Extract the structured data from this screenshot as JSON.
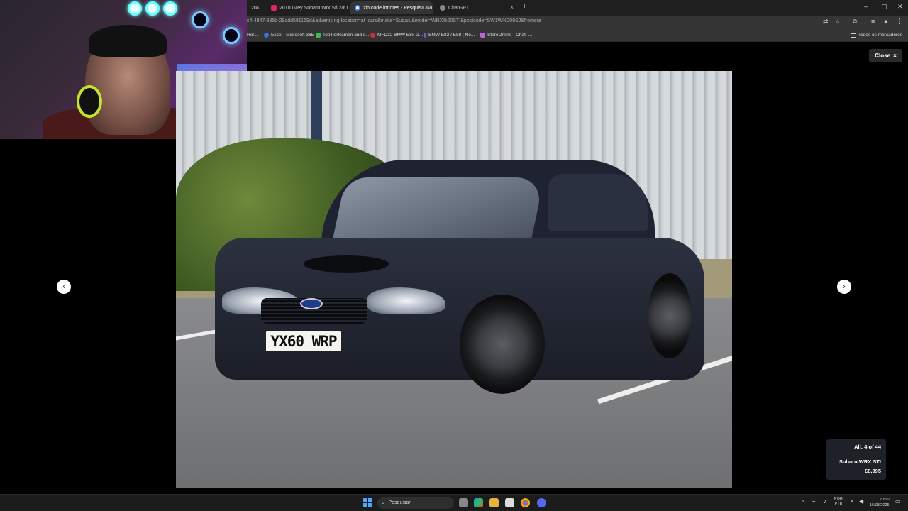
{
  "tabs": [
    {
      "label": "20"
    },
    {
      "label": "2010 Grey Subaru Wrx Sti 2.5T"
    },
    {
      "label": "zip code londres - Pesquisa Go"
    },
    {
      "label": "ChatGPT"
    }
  ],
  "address": {
    "url": "s4-4947-885b-29ddd581169d&advertising-location=at_cars&make=Subaru&model=WRX%20STI&postcode=SW1W%209SJ&fromsra"
  },
  "bookmarks": [
    {
      "label": "Hor..."
    },
    {
      "label": "Excel | Microsoft 365"
    },
    {
      "label": "TopTierRamen and s..."
    },
    {
      "label": "MFD32 BMW E8x G..."
    },
    {
      "label": "BMW E82 / E88 | No..."
    },
    {
      "label": "StereOnline - Chat -..."
    }
  ],
  "bookmarks_all": "Todos os marcadores",
  "lightbox": {
    "close_label": "Close",
    "close_icon": "×",
    "prev_icon": "‹",
    "next_icon": "›",
    "plate_text": "YX60 WRP",
    "counter": "All: 4 of 44",
    "listing_name": "Subaru WRX STI",
    "price": "£8,995"
  },
  "taskbar": {
    "search_placeholder": "Pesquisar",
    "lang_line1": "POR",
    "lang_line2": "PTB",
    "time": "20:10",
    "date": "16/08/2025"
  },
  "colors": {
    "accent": "#4aa8ff",
    "card_bg": "#1e2128",
    "chrome_bg": "#353535"
  }
}
